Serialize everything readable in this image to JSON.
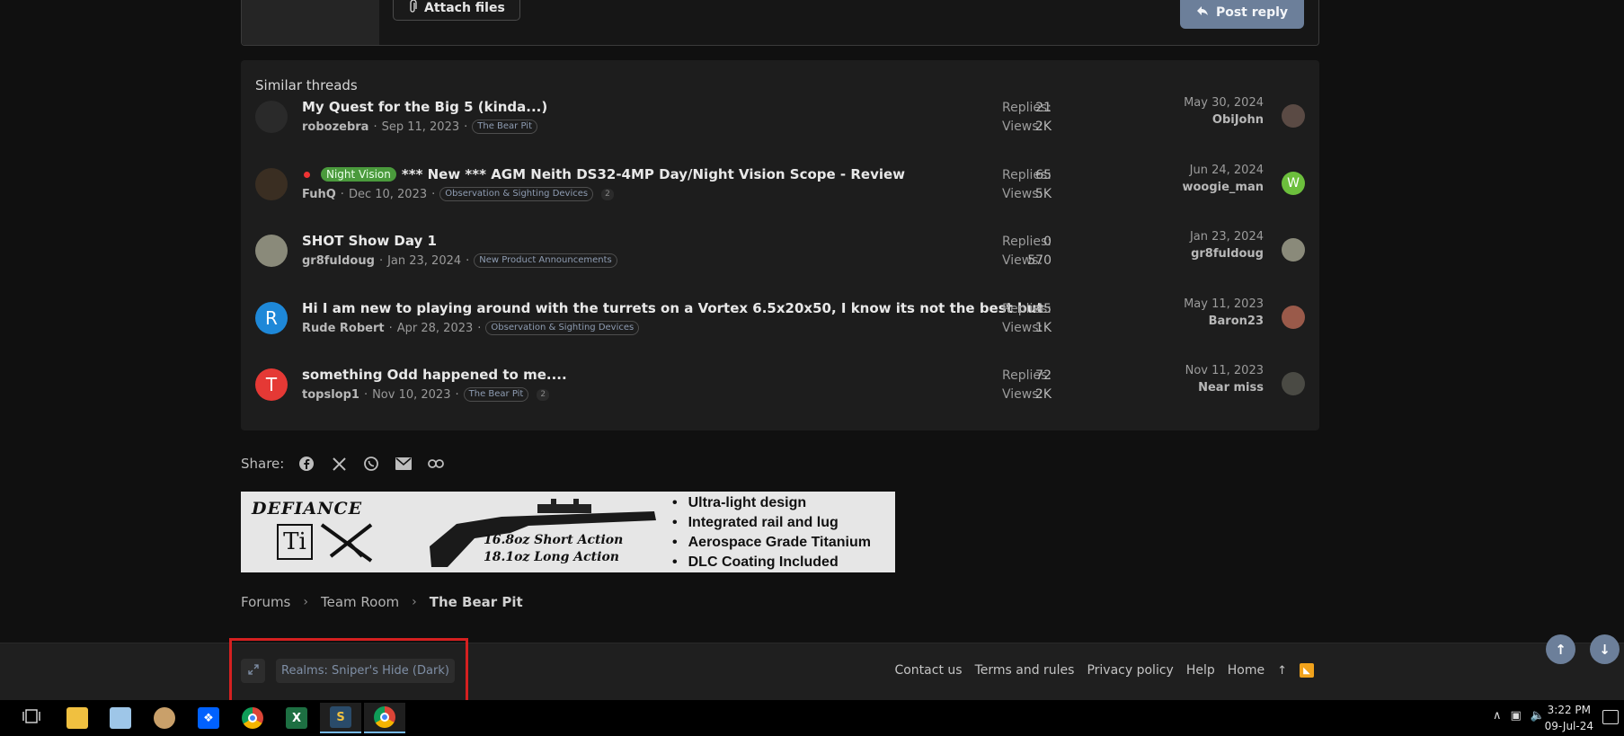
{
  "editor": {
    "attach_label": "Attach files",
    "post_reply_label": "Post reply"
  },
  "similar_threads": {
    "title": "Similar threads",
    "replies_label": "Replies:",
    "views_label": "Views:",
    "items": [
      {
        "title": "My Quest for the Big 5 (kinda...)",
        "prefix": "",
        "is_new": false,
        "author": "robozebra",
        "date": "Sep 11, 2023",
        "forum": "The Bear Pit",
        "pages": "",
        "replies": "21",
        "views": "2K",
        "last_date": "May 30, 2024",
        "last_user": "ObiJohn",
        "avatar_letter": "",
        "avatar_color": "#2a2a2a",
        "last_avatar_letter": "",
        "last_avatar_color": "#5a4a44"
      },
      {
        "title": "*** New *** AGM Neith DS32-4MP Day/Night Vision Scope - Review",
        "prefix": "Night Vision",
        "is_new": true,
        "author": "FuhQ",
        "date": "Dec 10, 2023",
        "forum": "Observation & Sighting Devices",
        "pages": "2",
        "replies": "65",
        "views": "5K",
        "last_date": "Jun 24, 2024",
        "last_user": "woogie_man",
        "avatar_letter": "",
        "avatar_color": "#3a2e22",
        "last_avatar_letter": "W",
        "last_avatar_color": "#6cbf3c"
      },
      {
        "title": "SHOT Show Day 1",
        "prefix": "",
        "is_new": false,
        "author": "gr8fuldoug",
        "date": "Jan 23, 2024",
        "forum": "New Product Announcements",
        "pages": "",
        "replies": "0",
        "views": "570",
        "last_date": "Jan 23, 2024",
        "last_user": "gr8fuldoug",
        "avatar_letter": "",
        "avatar_color": "#8a8a7a",
        "last_avatar_letter": "",
        "last_avatar_color": "#8a8a7a"
      },
      {
        "title": "Hi I am new to playing around with the turrets on a Vortex 6.5x20x50, I know its not the best but",
        "prefix": "",
        "is_new": false,
        "author": "Rude Robert",
        "date": "Apr 28, 2023",
        "forum": "Observation & Sighting Devices",
        "pages": "",
        "replies": "45",
        "views": "1K",
        "last_date": "May 11, 2023",
        "last_user": "Baron23",
        "avatar_letter": "R",
        "avatar_color": "#1e88d8",
        "last_avatar_letter": "",
        "last_avatar_color": "#9a5a4a"
      },
      {
        "title": "something Odd happened to me....",
        "prefix": "",
        "is_new": false,
        "author": "topslop1",
        "date": "Nov 10, 2023",
        "forum": "The Bear Pit",
        "pages": "2",
        "replies": "72",
        "views": "2K",
        "last_date": "Nov 11, 2023",
        "last_user": "Near miss",
        "avatar_letter": "T",
        "avatar_color": "#e53935",
        "last_avatar_letter": "",
        "last_avatar_color": "#4a4a44"
      }
    ]
  },
  "share": {
    "label": "Share:"
  },
  "banner": {
    "brand": "DEFIANCE",
    "model": "Ti",
    "weight_short": "16.8oz Short Action",
    "weight_long": "18.1oz Long Action",
    "features": [
      "Ultra-light design",
      "Integrated rail and lug",
      "Aerospace Grade Titanium",
      "DLC Coating Included"
    ]
  },
  "breadcrumb": {
    "items": [
      "Forums",
      "Team Room",
      "The Bear Pit"
    ]
  },
  "footer": {
    "style_chooser": "Realms: Sniper's Hide (Dark)",
    "links": [
      "Contact us",
      "Terms and rules",
      "Privacy policy",
      "Help",
      "Home"
    ]
  },
  "taskbar": {
    "time": "3:22 PM",
    "date": "09-Jul-24"
  }
}
